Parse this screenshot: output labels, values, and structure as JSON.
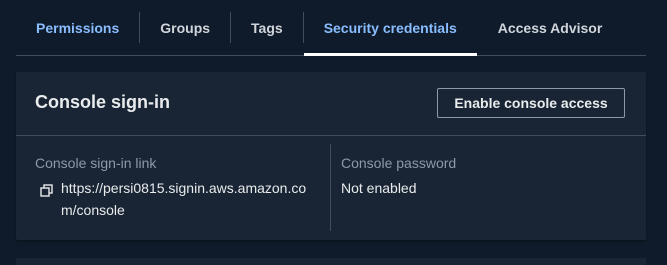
{
  "tabs": [
    {
      "label": "Permissions",
      "active": false
    },
    {
      "label": "Groups",
      "active": false
    },
    {
      "label": "Tags",
      "active": false
    },
    {
      "label": "Security credentials",
      "active": true
    },
    {
      "label": "Access Advisor",
      "active": false
    }
  ],
  "panel": {
    "title": "Console sign-in",
    "enable_button": "Enable console access",
    "signin_link": {
      "label": "Console sign-in link",
      "url_line1": "https://persi0815.signin.aws.amazon.co",
      "url_line2": "m/console"
    },
    "password": {
      "label": "Console password",
      "value": "Not enabled"
    }
  },
  "colors": {
    "background": "#0f1b2a",
    "panel": "#192534",
    "active_tab": "#89bdff",
    "text": "#e9ebed",
    "muted": "#8d99a8",
    "divider": "#414d5c"
  },
  "icons": {
    "copy": "copy-icon"
  }
}
